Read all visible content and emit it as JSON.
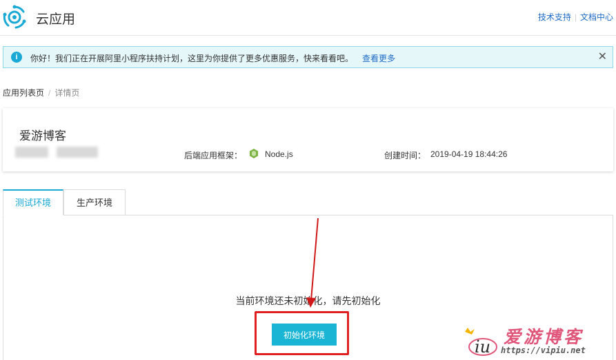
{
  "header": {
    "app_title": "云应用",
    "links": [
      "技术支持",
      "文档中心"
    ]
  },
  "notice": {
    "icon": "info-icon",
    "text": "你好！我们正在开展阿里小程序扶持计划，这里为你提供了更多优惠服务，快来看看吧。",
    "link": "查看更多",
    "close_icon": "close-icon"
  },
  "breadcrumb": {
    "items": [
      "应用列表页",
      "详情页"
    ],
    "separator": "/"
  },
  "app_info": {
    "name": "爱游博客",
    "framework_label": "后端应用框架：",
    "framework_icon": "nodejs-icon",
    "framework_value": "Node.js",
    "created_label": "创建时间：",
    "created_value": "2019-04-19 18:44:26"
  },
  "tabs": [
    {
      "label": "测试环境",
      "active": true
    },
    {
      "label": "生产环境",
      "active": false
    }
  ],
  "panel": {
    "empty_message": "当前环境还未初始化，请先初始化",
    "init_button_label": "初始化环境"
  },
  "watermark": {
    "title": "爱游博客",
    "url": "https://vipiu.net"
  },
  "colors": {
    "accent": "#1ab5d5",
    "link": "#1f6bc4",
    "notice_bg": "#e6f7fa",
    "annotation_red": "#e02020",
    "watermark_pink": "#e0567a"
  }
}
